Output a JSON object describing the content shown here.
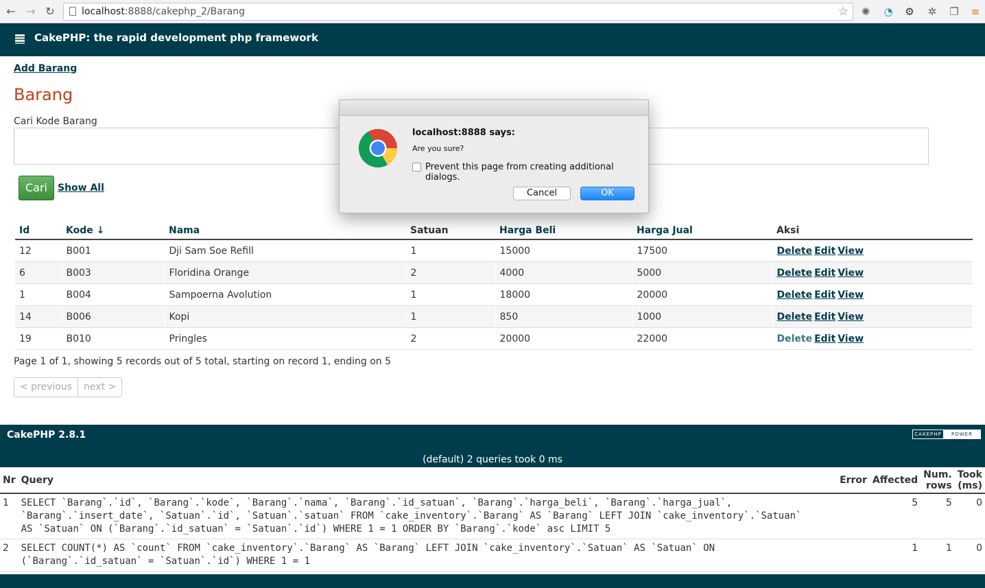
{
  "browser": {
    "url_host": "localhost",
    "url_path": ":8888/cakephp_2/Barang"
  },
  "header": {
    "title": "CakePHP: the rapid development php framework"
  },
  "content": {
    "add_link": "Add Barang",
    "title": "Barang",
    "search_label": "Cari Kode Barang",
    "search_value": "",
    "search_button": "Cari",
    "show_all": "Show All"
  },
  "table": {
    "headers": [
      "Id",
      "Kode ↓",
      "Nama",
      "Satuan",
      "Harga Beli",
      "Harga Jual",
      "Aksi"
    ],
    "rows": [
      [
        "12",
        "B001",
        "Dji Sam Soe Refill",
        "1",
        "15000",
        "17500"
      ],
      [
        "6",
        "B003",
        "Floridina Orange",
        "2",
        "4000",
        "5000"
      ],
      [
        "1",
        "B004",
        "Sampoerna Avolution",
        "1",
        "18000",
        "20000"
      ],
      [
        "14",
        "B006",
        "Kopi",
        "1",
        "850",
        "1000"
      ],
      [
        "19",
        "B010",
        "Pringles",
        "2",
        "20000",
        "22000"
      ]
    ],
    "actions": [
      "Delete",
      "Edit",
      "View"
    ]
  },
  "paging": {
    "info": "Page 1 of 1, showing 5 records out of 5 total, starting on record 1, ending on 5",
    "previous": "< previous",
    "next": "next >"
  },
  "footer": {
    "version": "CakePHP 2.8.1",
    "power_a": "CAKEPHP",
    "power_b": "POWER",
    "query_summary": "(default) 2 queries took 0 ms"
  },
  "sql_log": {
    "headers": [
      "Nr",
      "Query",
      "Error",
      "Affected",
      "Num. rows",
      "Took (ms)"
    ],
    "rows": [
      {
        "nr": "1",
        "query": "SELECT `Barang`.`id`, `Barang`.`kode`, `Barang`.`nama`, `Barang`.`id_satuan`, `Barang`.`harga_beli`, `Barang`.`harga_jual`,\n`Barang`.`insert_date`, `Satuan`.`id`, `Satuan`.`satuan` FROM `cake_inventory`.`Barang` AS `Barang` LEFT JOIN `cake_inventory`.`Satuan`\nAS `Satuan` ON (`Barang`.`id_satuan` = `Satuan`.`id`) WHERE 1 = 1 ORDER BY `Barang`.`kode` asc LIMIT 5",
        "error": "",
        "affected": "5",
        "num_rows": "5",
        "took": "0"
      },
      {
        "nr": "2",
        "query": "SELECT COUNT(*) AS `count` FROM `cake_inventory`.`Barang` AS `Barang` LEFT JOIN `cake_inventory`.`Satuan` AS `Satuan` ON\n(`Barang`.`id_satuan` = `Satuan`.`id`) WHERE 1 = 1",
        "error": "",
        "affected": "1",
        "num_rows": "1",
        "took": "0"
      }
    ]
  },
  "dialog": {
    "title": "localhost:8888 says:",
    "message": "Are you sure?",
    "checkbox_label": "Prevent this page from creating additional dialogs.",
    "checkbox_checked": false,
    "cancel": "Cancel",
    "ok": "OK"
  },
  "colors": {
    "cake_header": "#003d4c",
    "title_red": "#c73e14",
    "button_green": "#3c8f3b",
    "dialog_ok_blue": "#1b86fb"
  }
}
